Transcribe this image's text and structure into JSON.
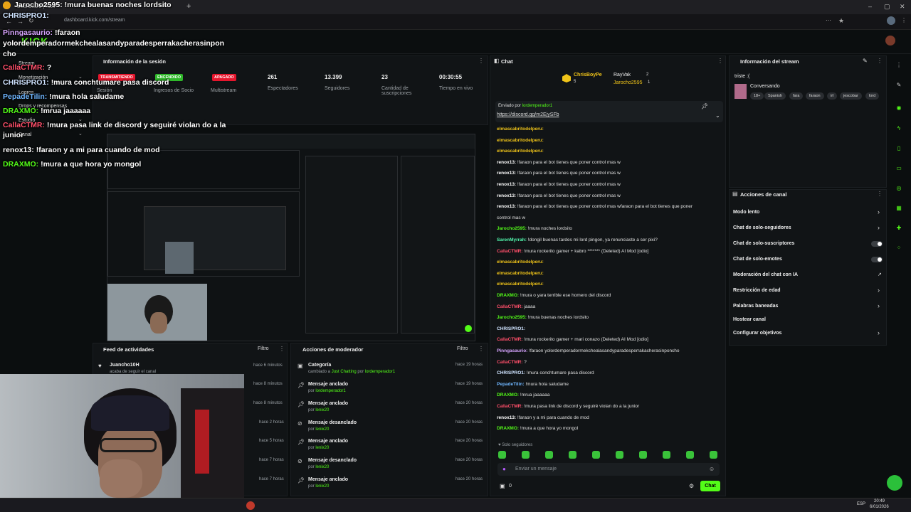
{
  "browser": {
    "tab_title": "Jarocho2595: !mura buenas noches lordsito",
    "url": "dashboard.kick.com/stream",
    "clock_time": "20:49",
    "clock_date": "6/01/2026",
    "lang": "ESP"
  },
  "overlay_chat": [
    {
      "user": "CHRISPRO1:",
      "text": "",
      "color": "#cfe3ff"
    },
    {
      "user": "Pinngasaurio:",
      "text": "!faraon",
      "color": "#d7a4ff"
    },
    {
      "user": "",
      "text": "yolordemperadormekchealasandyparadesperrakacherasinpon",
      "color": "#ffffff"
    },
    {
      "user": "",
      "text": "cho",
      "color": "#ffffff"
    },
    {
      "user": "CallaCTMR:",
      "text": "?",
      "color": "#ff4f6a"
    },
    {
      "user": "CHRISPRO1:",
      "text": "!mura conchtumare pasa discord",
      "color": "#cfe3ff"
    },
    {
      "user": "PepadeTilin:",
      "text": "!mura hola saludame",
      "color": "#6fb6ff"
    },
    {
      "user": "DRAXMO:",
      "text": "!mrua jaaaaaa",
      "color": "#53fc18"
    },
    {
      "user": "CallaCTMR:",
      "text": "!mura pasa link de discord y seguiré violan do a la",
      "color": "#ff4f6a"
    },
    {
      "user": "",
      "text": "junior",
      "color": "#ffffff"
    },
    {
      "user": "renox13:",
      "text": "!faraon y a mi para cuando de mod",
      "color": "#ffffff"
    },
    {
      "user": "DRAXMO:",
      "text": "!mura a que hora yo mongol",
      "color": "#53fc18"
    }
  ],
  "sidebar": {
    "items": [
      "Stream",
      "Monetización",
      "Logros",
      "Drops y recompensas",
      "Estudio",
      "Canal"
    ]
  },
  "session": {
    "title": "Información de la sesión",
    "stats": [
      {
        "badge": "TRANSMITIENDO",
        "label": "Sesión"
      },
      {
        "badge": "ENCENDIDO",
        "label": "Ingresos de Socio"
      },
      {
        "badge": "APAGADO",
        "label": "Multistream"
      },
      {
        "value": "261",
        "label": "Espectadores"
      },
      {
        "value": "13.399",
        "label": "Seguidores"
      },
      {
        "value": "23",
        "label": "Cantidad de suscripciones"
      },
      {
        "value": "00:30:55",
        "label": "Tiempo en vivo"
      }
    ]
  },
  "activity": {
    "title": "Feed de actividades",
    "filter": "Filtro",
    "items": [
      {
        "name": "Juancho10H",
        "sub": "acaba de seguir el canal",
        "time": "hace 6 minutos"
      },
      {
        "time": "hace 8 minutos"
      },
      {
        "time": "hace 8 minutos"
      },
      {
        "time": "hace 2 horas"
      },
      {
        "time": "hace 5 horas"
      },
      {
        "time": "hace 7 horas"
      },
      {
        "time": "hace 7 horas"
      }
    ]
  },
  "mod_actions": {
    "title": "Acciones de moderador",
    "filter": "Filtro",
    "items": [
      {
        "title": "Categoría",
        "sub": "cambiado a",
        "target": "Just Chatting",
        "by": "por",
        "user": "lordemperador1",
        "time": "hace 19 horas"
      },
      {
        "title": "Mensaje anclado",
        "by": "por",
        "user": "lordemperador1",
        "time": "hace 19 horas"
      },
      {
        "title": "Mensaje anclado",
        "by": "por",
        "user": "lenix20",
        "time": "hace 20 horas"
      },
      {
        "title": "Mensaje desanclado",
        "by": "por",
        "user": "lenix20",
        "time": "hace 20 horas"
      },
      {
        "title": "Mensaje anclado",
        "by": "por",
        "user": "lenix20",
        "time": "hace 20 horas"
      },
      {
        "title": "Mensaje desanclado",
        "by": "por",
        "user": "lenix20",
        "time": "hace 20 horas"
      },
      {
        "title": "Mensaje anclado",
        "by": "por",
        "user": "lenix20",
        "time": "hace 20 horas"
      }
    ]
  },
  "chat": {
    "title": "Chat",
    "top_users": [
      {
        "name": "ChrisBoyPe",
        "count": "5"
      },
      {
        "name": "RayVak",
        "count": "2"
      },
      {
        "name": "Jarocho2595",
        "count": "1"
      }
    ],
    "pinned_label": "Enviado por",
    "pinned_user": "lordemperador1",
    "pinned_link": "https://discord.gg/m2EjySFb",
    "messages": [
      {
        "user": "elmascabritodelperu:",
        "text": "",
        "color": "#f0c419"
      },
      {
        "user": "elmascabritodelperu:",
        "text": "",
        "color": "#f0c419"
      },
      {
        "user": "elmascabritodelperu:",
        "text": "",
        "color": "#f0c419"
      },
      {
        "user": "renox13:",
        "text": "!faraon para el bot tienes que poner control mas w",
        "color": "#ffffff"
      },
      {
        "user": "renox13:",
        "text": "!faraon para el bot tienes que poner control mas w",
        "color": "#ffffff"
      },
      {
        "user": "renox13:",
        "text": "!faraon para el bot tienes que poner control mas w",
        "color": "#ffffff"
      },
      {
        "user": "renox13:",
        "text": "!faraon para el bot tienes que poner control mas w",
        "color": "#ffffff"
      },
      {
        "user": "renox13:",
        "text": "!faraon para el bot tienes que poner control mas wfaraon para el bot tienes que poner",
        "color": "#ffffff"
      },
      {
        "user": "",
        "text": "control mas w",
        "color": "#ffffff"
      },
      {
        "user": "Jarocho2595:",
        "text": "!mura noches lordsito",
        "color": "#53fc18"
      },
      {
        "user": "SarenMyrrah:",
        "text": "!dongil buenas tardes mi lord pingon, ya renunciaste a ser pixi?",
        "color": "#53fcb0"
      },
      {
        "user": "CallaCTMR:",
        "text": "!mura rockerito gamer + kabro ******* (Deleted) AI Mod [odio]",
        "color": "#ff4f6a"
      },
      {
        "user": "elmascabritodelperu:",
        "text": "",
        "color": "#f0c419"
      },
      {
        "user": "elmascabritodelperu:",
        "text": "",
        "color": "#f0c419"
      },
      {
        "user": "elmascabritodelperu:",
        "text": "",
        "color": "#f0c419"
      },
      {
        "user": "DRAXMO:",
        "text": "!mura o yara terrible ese homero del discord",
        "color": "#53fc18"
      },
      {
        "user": "CallaCTMR:",
        "text": "jaaaa",
        "color": "#ff4f6a"
      },
      {
        "user": "Jarocho2595:",
        "text": "!mura buenas noches lordsito",
        "color": "#53fc18"
      },
      {
        "user": "CHRISPRO1:",
        "text": "",
        "color": "#cfe3ff"
      },
      {
        "user": "CallaCTMR:",
        "text": "!mura rockerito gamer + mari conazo (Deleted) AI Mod [odio]",
        "color": "#ff4f6a"
      },
      {
        "user": "Pinngasaurio:",
        "text": "!faraon yolordemperadormekchealasandyparadesperrakacherasinponcho",
        "color": "#d7a4ff"
      },
      {
        "user": "CallaCTMR:",
        "text": "?",
        "color": "#ff4f6a"
      },
      {
        "user": "CHRISPRO1:",
        "text": "!mura conchtumare pasa discord",
        "color": "#cfe3ff"
      },
      {
        "user": "PepadeTilin:",
        "text": "!mura hola saludame",
        "color": "#6fb6ff"
      },
      {
        "user": "DRAXMO:",
        "text": "!mrua jaaaaaa",
        "color": "#53fc18"
      },
      {
        "user": "CallaCTMR:",
        "text": "!mura pasa link de discord y seguiré violan do a la junior",
        "color": "#ff4f6a"
      },
      {
        "user": "renox13:",
        "text": "!faraon y a mi para cuando de mod",
        "color": "#ffffff"
      },
      {
        "user": "DRAXMO:",
        "text": "!mura a que hora yo mongol",
        "color": "#53fc18"
      }
    ],
    "followers_only": "Solo seguidores",
    "input_placeholder": "Enviar un mensaje",
    "points": "0",
    "send_label": "Chat"
  },
  "stream_info": {
    "title": "Información del stream",
    "stream_title": "triste :(",
    "category": "Conversando",
    "tags": [
      "18+",
      "Spanish",
      "fara",
      "faraon",
      "irl",
      "jescobar",
      "lord"
    ]
  },
  "channel_actions": {
    "title": "Acciones de canal",
    "items": [
      {
        "label": "Modo lento",
        "control": "chevron"
      },
      {
        "label": "Chat de solo-seguidores",
        "control": "chevron"
      },
      {
        "label": "Chat de solo-suscriptores",
        "control": "toggle"
      },
      {
        "label": "Chat de solo-emotes",
        "control": "toggle"
      },
      {
        "label": "Moderación del chat con IA",
        "control": "link"
      },
      {
        "label": "Restricción de edad",
        "control": "chevron"
      },
      {
        "label": "Palabras baneadas",
        "control": "chevron"
      },
      {
        "label": "Hostear canal",
        "control": "none"
      },
      {
        "label": "Configurar objetivos",
        "control": "chevron"
      }
    ]
  },
  "colors": {
    "accent": "#53fc18",
    "live_red": "#e6162d",
    "bg": "#0b0e0f",
    "panel": "#111416"
  }
}
